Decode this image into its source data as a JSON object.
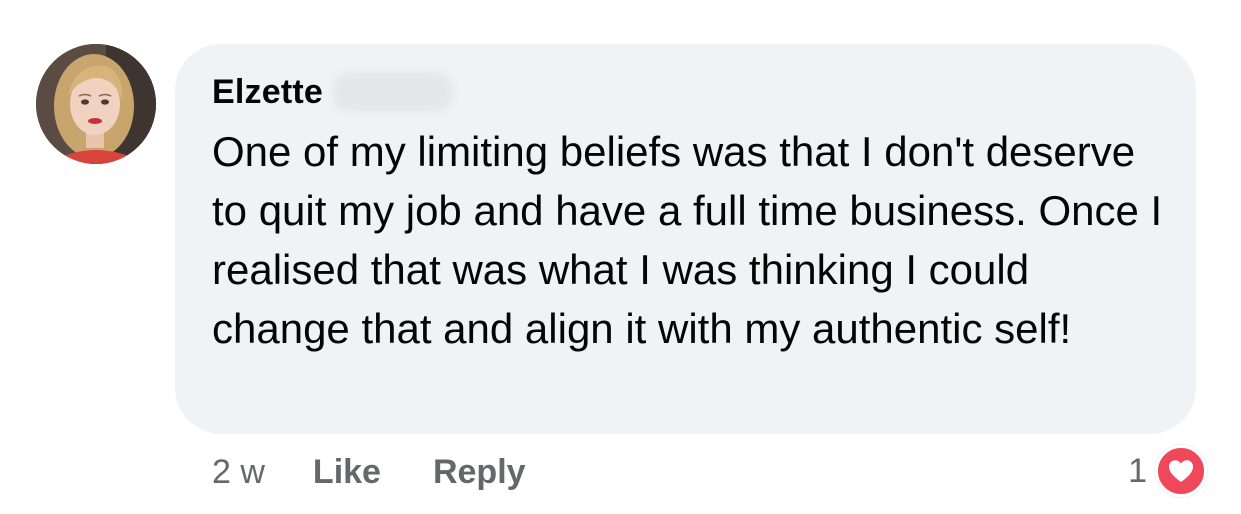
{
  "comment": {
    "author": "Elzette",
    "text": "One of my limiting beliefs was that I don't deserve to quit my job and have a full time business. Once I realised that was what I was thinking I could change that and align it with my authentic self!",
    "timestamp": "2 w",
    "like_label": "Like",
    "reply_label": "Reply",
    "reaction_count": "1",
    "reaction_icon": "heart-icon"
  },
  "colors": {
    "bubble_background": "#f0f2f5",
    "secondary_text": "#65676b",
    "heart": "#f0485b"
  }
}
